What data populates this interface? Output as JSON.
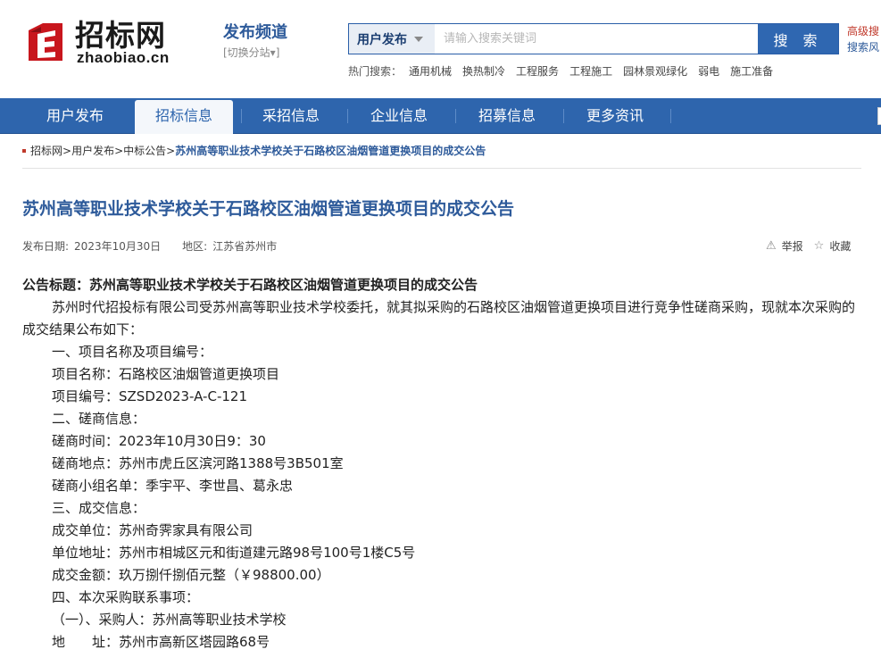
{
  "header": {
    "logo_cn": "招标网",
    "logo_en": "zhaobiao.cn",
    "channel_title": "发布频道",
    "channel_switch": "[切换分站▾]",
    "search_type": "用户发布",
    "search_placeholder": "请输入搜索关键词",
    "search_button": "搜 索",
    "advanced_search": "高级搜",
    "search_style": "搜索风",
    "hot_label": "热门搜索：",
    "hot_items": [
      "通用机械",
      "换热制冷",
      "工程服务",
      "工程施工",
      "园林景观绿化",
      "弱电",
      "施工准备"
    ]
  },
  "nav": {
    "items": [
      "用户发布",
      "招标信息",
      "采招信息",
      "企业信息",
      "招募信息",
      "更多资讯"
    ],
    "active": "招标信息"
  },
  "breadcrumb": {
    "items": [
      "招标网",
      "用户发布",
      "中标公告"
    ],
    "sep": ">",
    "current": "苏州高等职业技术学校关于石路校区油烟管道更换项目的成交公告"
  },
  "article": {
    "title": "苏州高等职业技术学校关于石路校区油烟管道更换项目的成交公告",
    "date_label": "发布日期:",
    "date": "2023年10月30日",
    "region_label": "地区:",
    "region": "江苏省苏州市",
    "report": "举报",
    "favorite": "收藏",
    "heading": "公告标题：苏州高等职业技术学校关于石路校区油烟管道更换项目的成交公告",
    "intro": "苏州时代招投标有限公司受苏州高等职业技术学校委托，就其拟采购的石路校区油烟管道更换项目进行竞争性磋商采购，现就本次采购的成交结果公布如下：",
    "lines": [
      "一、项目名称及项目编号：",
      "项目名称：石路校区油烟管道更换项目",
      "项目编号：SZSD2023-A-C-121",
      "二、磋商信息：",
      "磋商时间：2023年10月30日9：30",
      "磋商地点：苏州市虎丘区滨河路1388号3B501室",
      "磋商小组名单：季宇平、李世昌、葛永忠",
      "三、成交信息：",
      "成交单位：苏州奇霁家具有限公司",
      "单位地址：苏州市相城区元和街道建元路98号100号1楼C5号",
      "成交金额：玖万捌仟捌佰元整（￥98800.00）",
      "四、本次采购联系事项：",
      "（一）、采购人：苏州高等职业技术学校",
      "地　　址：苏州市高新区塔园路68号"
    ]
  }
}
